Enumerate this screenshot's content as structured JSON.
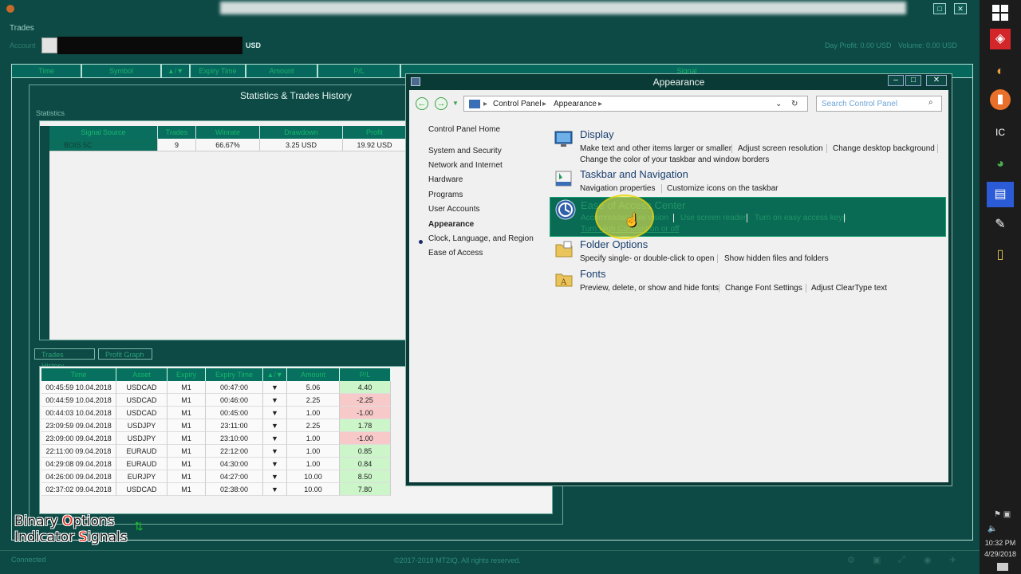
{
  "trading_app": {
    "trades_label": "Trades",
    "account_label": "Account",
    "account_currency": "USD",
    "day_profit": "Day Profit: 0.00 USD",
    "volume": "Volume: 0.00 USD",
    "columns": [
      "Time",
      "Symbol",
      "▲/▼",
      "Expiry Time",
      "Amount",
      "P/L",
      "Signal"
    ],
    "connected": "Connected",
    "copyright": "©2017-2018 MT2IQ. All rights reserved."
  },
  "stats": {
    "title": "Statistics & Trades History",
    "subtitle": "Statistics",
    "columns": [
      "Signal Source",
      "Trades",
      "Winrate",
      "Drawdown",
      "Profit"
    ],
    "row": {
      "source": "BOIS 5C",
      "trades": "9",
      "winrate": "66.67%",
      "drawdown": "3.25 USD",
      "profit": "19.92 USD"
    },
    "tabs": [
      "Trades History",
      "Profit Graph"
    ],
    "history_columns": [
      "Time",
      "Asset",
      "Expiry",
      "Expiry Time",
      "▲/▼",
      "Amount",
      "P/L"
    ],
    "history_rows": [
      {
        "time": "00:45:59 10.04.2018",
        "asset": "USDCAD",
        "expiry": "M1",
        "expiry_time": "00:47:00",
        "dir": "▼",
        "amount": "5.06",
        "pl": "4.40",
        "pl_sign": "pos"
      },
      {
        "time": "00:44:59 10.04.2018",
        "asset": "USDCAD",
        "expiry": "M1",
        "expiry_time": "00:46:00",
        "dir": "▼",
        "amount": "2.25",
        "pl": "-2.25",
        "pl_sign": "neg"
      },
      {
        "time": "00:44:03 10.04.2018",
        "asset": "USDCAD",
        "expiry": "M1",
        "expiry_time": "00:45:00",
        "dir": "▼",
        "amount": "1.00",
        "pl": "-1.00",
        "pl_sign": "neg"
      },
      {
        "time": "23:09:59 09.04.2018",
        "asset": "USDJPY",
        "expiry": "M1",
        "expiry_time": "23:11:00",
        "dir": "▼",
        "amount": "2.25",
        "pl": "1.78",
        "pl_sign": "pos"
      },
      {
        "time": "23:09:00 09.04.2018",
        "asset": "USDJPY",
        "expiry": "M1",
        "expiry_time": "23:10:00",
        "dir": "▼",
        "amount": "1.00",
        "pl": "-1.00",
        "pl_sign": "neg"
      },
      {
        "time": "22:11:00 09.04.2018",
        "asset": "EURAUD",
        "expiry": "M1",
        "expiry_time": "22:12:00",
        "dir": "▼",
        "amount": "1.00",
        "pl": "0.85",
        "pl_sign": "pos"
      },
      {
        "time": "04:29:08 09.04.2018",
        "asset": "EURAUD",
        "expiry": "M1",
        "expiry_time": "04:30:00",
        "dir": "▼",
        "amount": "1.00",
        "pl": "0.84",
        "pl_sign": "pos"
      },
      {
        "time": "04:26:00 09.04.2018",
        "asset": "EURJPY",
        "expiry": "M1",
        "expiry_time": "04:27:00",
        "dir": "▼",
        "amount": "10.00",
        "pl": "8.50",
        "pl_sign": "pos"
      },
      {
        "time": "02:37:02 09.04.2018",
        "asset": "USDCAD",
        "expiry": "M1",
        "expiry_time": "02:38:00",
        "dir": "▼",
        "amount": "10.00",
        "pl": "7.80",
        "pl_sign": "pos"
      }
    ]
  },
  "brand": {
    "line1_a": "Binary ",
    "line1_b": "O",
    "line1_c": "ptions",
    "line2_a": "Indicator ",
    "line2_b": "S",
    "line2_c": "ignals",
    "arrows": "⇅"
  },
  "control_panel": {
    "title": "Appearance",
    "breadcrumb": [
      "Control Panel",
      "Appearance"
    ],
    "search_placeholder": "Search Control Panel",
    "side_items": [
      "Control Panel Home",
      "System and Security",
      "Network and Internet",
      "Hardware",
      "Programs",
      "User Accounts",
      "Appearance",
      "Clock, Language, and Region",
      "Ease of Access"
    ],
    "categories": {
      "display": {
        "title": "Display",
        "links": [
          "Make text and other items larger or smaller",
          "Adjust screen resolution",
          "Change desktop background"
        ],
        "links2": [
          "Change the color of your taskbar and window borders"
        ]
      },
      "taskbar": {
        "title": "Taskbar and Navigation",
        "links": [
          "Navigation properties",
          "Customize icons on the taskbar"
        ]
      },
      "ease": {
        "title": "Ease of Access Center",
        "links": [
          "Accommodate low vision",
          "Use screen reader",
          "Turn on easy access keys"
        ],
        "links2": [
          "Turn High Contrast on or off"
        ]
      },
      "folder": {
        "title": "Folder Options",
        "links": [
          "Specify single- or double-click to open",
          "Show hidden files and folders"
        ]
      },
      "fonts": {
        "title": "Fonts",
        "links": [
          "Preview, delete, or show and hide fonts",
          "Change Font Settings",
          "Adjust ClearType text"
        ]
      }
    }
  },
  "taskbar": {
    "clock": "10:32 PM",
    "date": "4/29/2018"
  }
}
